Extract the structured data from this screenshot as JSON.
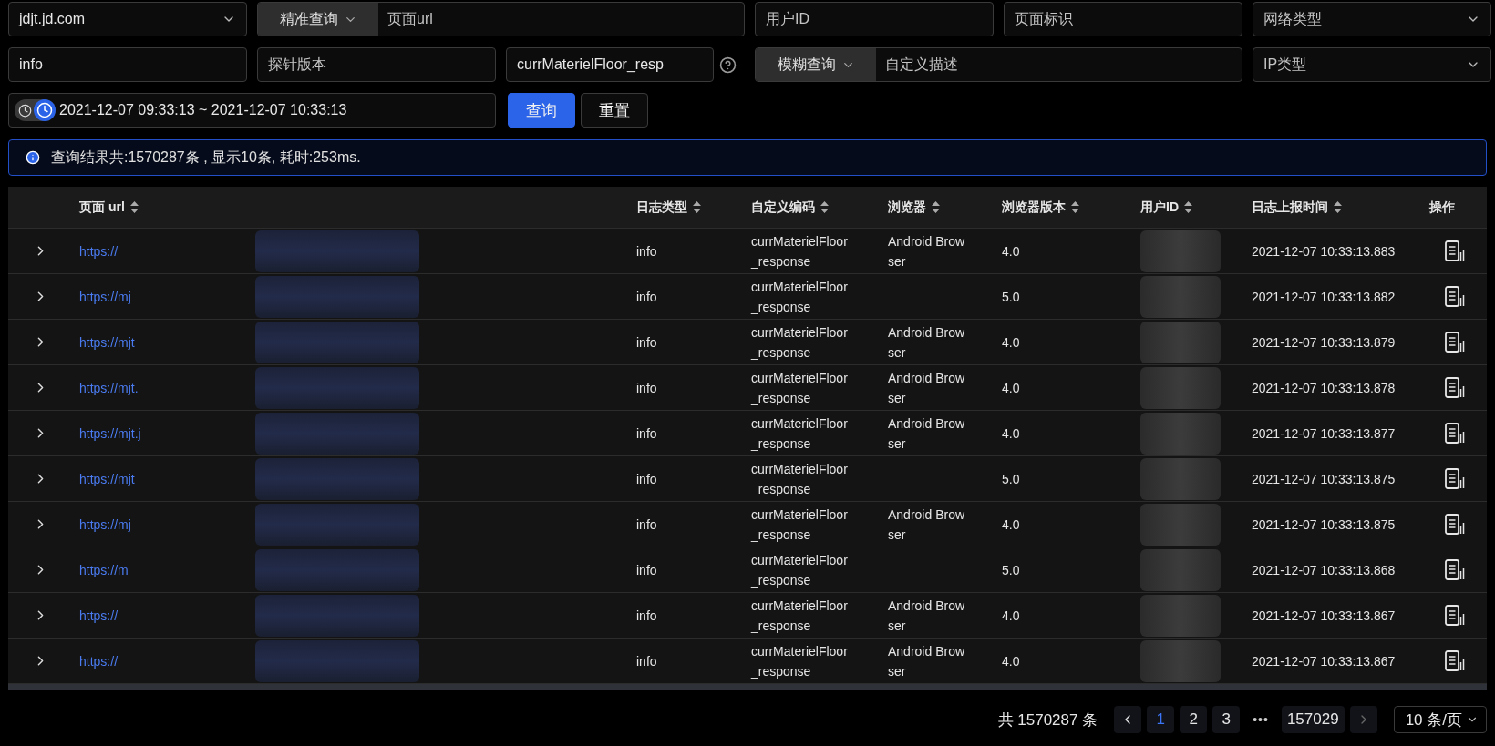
{
  "filters": {
    "domain_select": {
      "value": "jdjt.jd.com"
    },
    "url_query": {
      "mode": "精准查询",
      "placeholder": "页面url"
    },
    "user_id": {
      "placeholder": "用户ID"
    },
    "page_tag": {
      "placeholder": "页面标识"
    },
    "network_type": {
      "placeholder": "网络类型"
    },
    "log_type": {
      "value": "info"
    },
    "probe_version": {
      "placeholder": "探针版本"
    },
    "custom_code": {
      "value": "currMaterielFloor_resp"
    },
    "desc_query": {
      "mode": "模糊查询",
      "placeholder": "自定义描述"
    },
    "ip_type": {
      "placeholder": "IP类型"
    },
    "time_range": "2021-12-07 09:33:13 ~ 2021-12-07 10:33:13"
  },
  "buttons": [
    {
      "label": "查询",
      "kind": "primary"
    },
    {
      "label": "重置",
      "kind": "default"
    }
  ],
  "alert": "查询结果共:1570287条 , 显示10条, 耗时:253ms.",
  "table": {
    "columns": [
      {
        "label": "页面 url",
        "sortable": true
      },
      {
        "label": "日志类型",
        "sortable": true
      },
      {
        "label": "自定义编码",
        "sortable": true
      },
      {
        "label": "浏览器",
        "sortable": true
      },
      {
        "label": "浏览器版本",
        "sortable": true
      },
      {
        "label": "用户ID",
        "sortable": true
      },
      {
        "label": "日志上报时间",
        "sortable": true
      },
      {
        "label": "操作",
        "sortable": false
      }
    ],
    "rows": [
      {
        "url": "https://",
        "log_type": "info",
        "custom_code": "currMaterielFloor_response",
        "browser": "Android Browser",
        "browser_version": "4.0",
        "time": "2021-12-07 10:33:13.883"
      },
      {
        "url": "https://mj",
        "log_type": "info",
        "custom_code": "currMaterielFloor_response",
        "browser_version": "5.0",
        "time": "2021-12-07 10:33:13.882"
      },
      {
        "url": "https://mjt",
        "log_type": "info",
        "custom_code": "currMaterielFloor_response",
        "browser": "Android Browser",
        "browser_version": "4.0",
        "time": "2021-12-07 10:33:13.879"
      },
      {
        "url": "https://mjt.",
        "log_type": "info",
        "custom_code": "currMaterielFloor_response",
        "browser": "Android Browser",
        "browser_version": "4.0",
        "time": "2021-12-07 10:33:13.878"
      },
      {
        "url": "https://mjt.j",
        "log_type": "info",
        "custom_code": "currMaterielFloor_response",
        "browser": "Android Browser",
        "browser_version": "4.0",
        "time": "2021-12-07 10:33:13.877"
      },
      {
        "url": "https://mjt",
        "log_type": "info",
        "custom_code": "currMaterielFloor_response",
        "browser_version": "5.0",
        "time": "2021-12-07 10:33:13.875"
      },
      {
        "url": "https://mj",
        "log_type": "info",
        "custom_code": "currMaterielFloor_response",
        "browser": "Android Browser",
        "browser_version": "4.0",
        "time": "2021-12-07 10:33:13.875"
      },
      {
        "url": "https://m",
        "log_type": "info",
        "custom_code": "currMaterielFloor_response",
        "browser_version": "5.0",
        "time": "2021-12-07 10:33:13.868"
      },
      {
        "url": "https://",
        "log_type": "info",
        "custom_code": "currMaterielFloor_response",
        "browser": "Android Browser",
        "browser_version": "4.0",
        "time": "2021-12-07 10:33:13.867"
      },
      {
        "url": "https://",
        "log_type": "info",
        "custom_code": "currMaterielFloor_response",
        "browser": "Android Browser",
        "browser_version": "4.0",
        "time": "2021-12-07 10:33:13.867"
      }
    ]
  },
  "pagination": {
    "total": "共 1570287 条",
    "pages": [
      {
        "label": "1",
        "selected": true
      },
      {
        "label": "2",
        "selected": false
      },
      {
        "label": "3",
        "selected": false
      }
    ],
    "ellipsis": "•••",
    "last_page": "157029",
    "page_size": "10 条/页"
  }
}
